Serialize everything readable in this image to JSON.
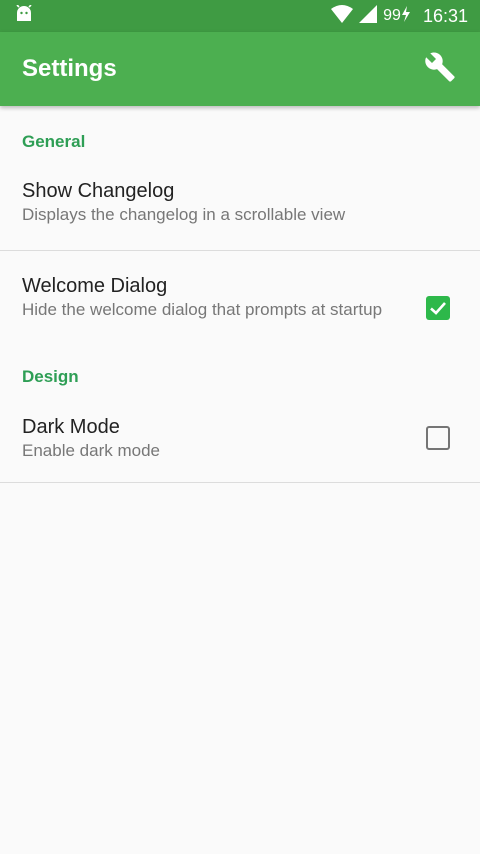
{
  "status_bar": {
    "battery": "99",
    "time": "16:31"
  },
  "app_bar": {
    "title": "Settings"
  },
  "sections": [
    {
      "header": "General",
      "items": [
        {
          "title": "Show Changelog",
          "summary": "Displays the changelog in a scrollable view"
        },
        {
          "title": "Welcome Dialog",
          "summary": "Hide the welcome dialog that prompts at startup",
          "checked": true
        }
      ]
    },
    {
      "header": "Design",
      "items": [
        {
          "title": "Dark Mode",
          "summary": "Enable dark mode",
          "checked": false
        }
      ]
    }
  ],
  "colors": {
    "status_bar": "#3f9b43",
    "app_bar": "#4caf50",
    "accent": "#2db84a",
    "category_text": "#2e9e55"
  }
}
